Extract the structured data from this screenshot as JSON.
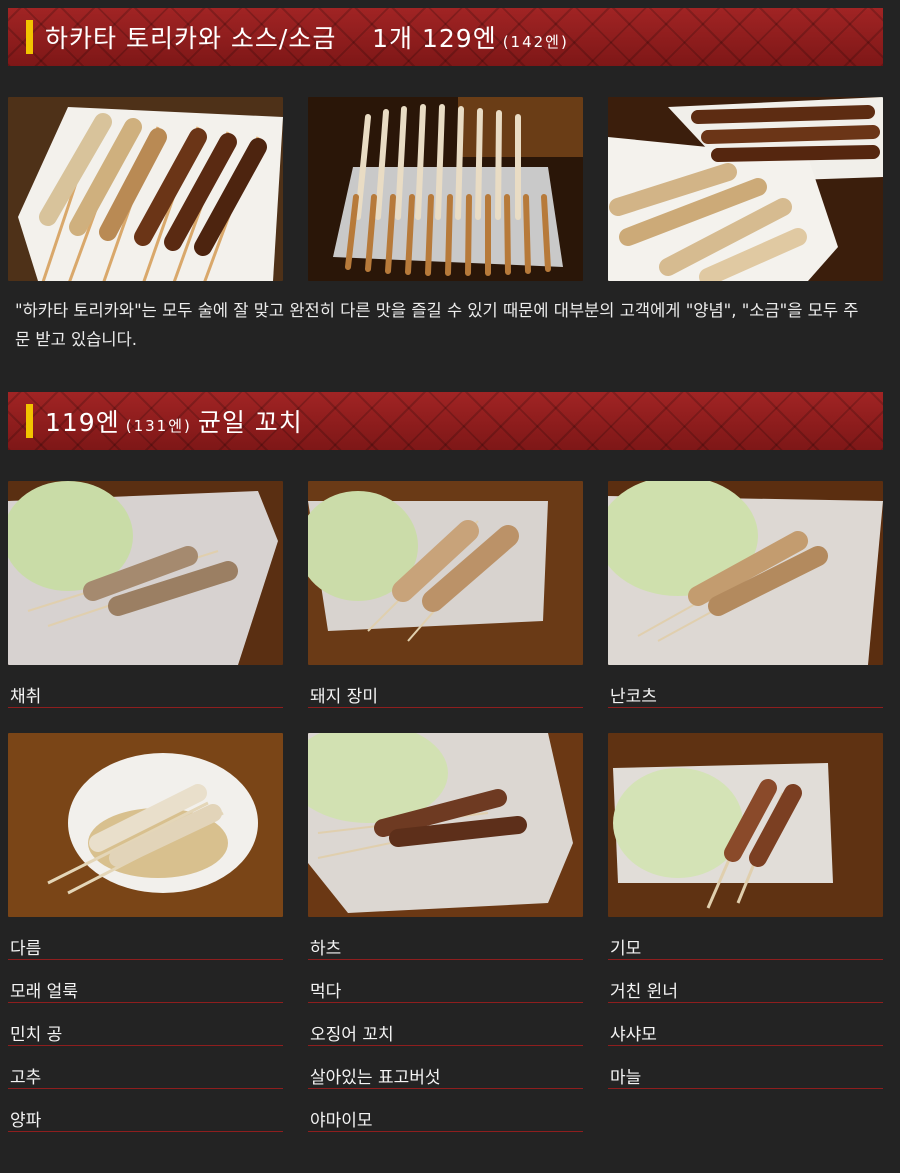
{
  "section1": {
    "title_prefix": "하카타 토리카와 소스/소금",
    "price": "1개 129엔",
    "price_tax": "(142엔)",
    "photos": [
      "skewers-on-plate-photo",
      "skewers-in-tray-photo",
      "skewers-two-plates-photo"
    ],
    "description": "\"하카타 토리카와\"는 모두 술에 잘 맞고 완전히 다른 맛을 즐길 수 있기 때문에 대부분의 고객에게 \"양념\", \"소금\"을 모두 주문 받고 있습니다."
  },
  "section2": {
    "price": "119엔",
    "price_tax": "(131엔)",
    "title_suffix": "균일 꼬치",
    "photo_items": [
      "채취",
      "돼지 장미",
      "난코츠",
      "다름",
      "하츠",
      "기모"
    ],
    "list_col1": [
      "모래 얼룩",
      "민치 공",
      "고추",
      "양파"
    ],
    "list_col2": [
      "먹다",
      "오징어 꼬치",
      "살아있는 표고버섯",
      "야마이모"
    ],
    "list_col3": [
      "거친 윈너",
      "샤샤모",
      "마늘"
    ]
  },
  "colors": {
    "background": "#232323",
    "header_red": "#8c1c1c",
    "accent_yellow": "#f2c400",
    "divider_red": "#8e1e1e"
  }
}
